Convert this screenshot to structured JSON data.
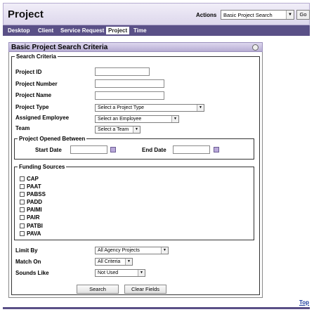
{
  "header": {
    "title": "Project",
    "actions_label": "Actions",
    "actions_selected": "Basic Project Search",
    "go_label": "Go"
  },
  "nav": {
    "items": [
      {
        "label": "Desktop"
      },
      {
        "label": "Client"
      },
      {
        "label": "Service Request"
      },
      {
        "label": "Project",
        "active": true
      },
      {
        "label": "Time"
      }
    ]
  },
  "panel": {
    "title": "Basic Project Search Criteria",
    "search_criteria_legend": "Search Criteria"
  },
  "fields": {
    "project_id": {
      "label": "Project ID",
      "value": ""
    },
    "project_number": {
      "label": "Project Number",
      "value": ""
    },
    "project_name": {
      "label": "Project Name",
      "value": ""
    },
    "project_type": {
      "label": "Project Type",
      "selected": "Select a Project Type"
    },
    "assigned_employee": {
      "label": "Assigned Employee",
      "selected": "Select an Employee"
    },
    "team": {
      "label": "Team",
      "selected": "Select a Team"
    }
  },
  "opened_between": {
    "legend": "Project Opened Between",
    "start_label": "Start Date",
    "end_label": "End Date",
    "start_value": "",
    "end_value": ""
  },
  "funding": {
    "legend": "Funding Sources",
    "items": [
      "CAP",
      "PAAT",
      "PABSS",
      "PADD",
      "PAIMI",
      "PAIR",
      "PATBI",
      "PAVA"
    ]
  },
  "options": {
    "limit_by": {
      "label": "Limit By",
      "selected": "All Agency Projects"
    },
    "match_on": {
      "label": "Match On",
      "selected": "All Criteria"
    },
    "sounds_like": {
      "label": "Sounds Like",
      "selected": "Not Used"
    }
  },
  "buttons": {
    "search": "Search",
    "clear": "Clear Fields"
  },
  "footer": {
    "top_link": "Top"
  }
}
